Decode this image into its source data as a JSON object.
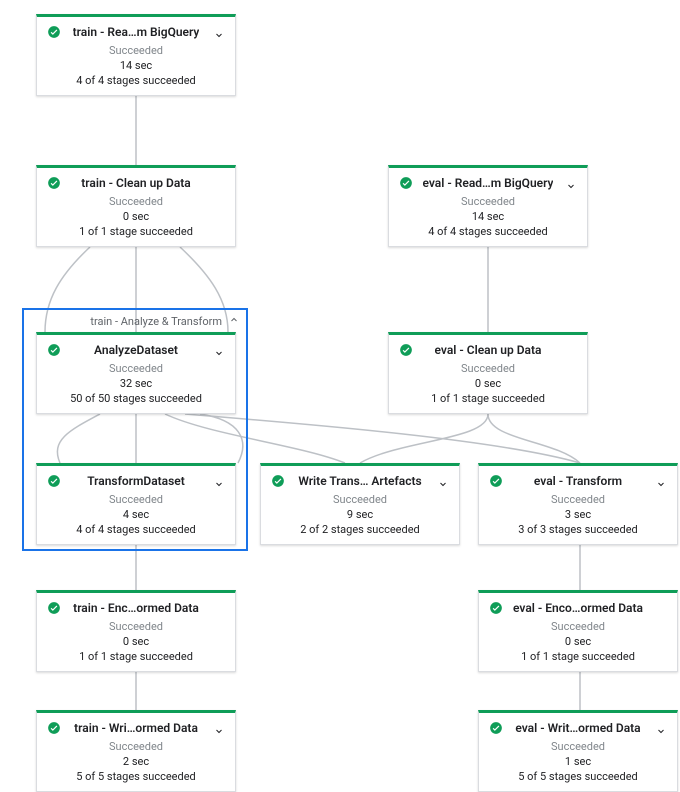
{
  "colors": {
    "success": "#0f9d58",
    "groupBorder": "#1a73e8"
  },
  "group": {
    "label": "train - Analyze & Transform"
  },
  "nodes": {
    "trainRead": {
      "title": "train - Rea…m BigQuery",
      "status": "Succeeded",
      "duration": "14 sec",
      "stages": "4 of 4 stages succeeded",
      "chevron": "down"
    },
    "trainClean": {
      "title": "train - Clean up Data",
      "status": "Succeeded",
      "duration": "0 sec",
      "stages": "1 of 1 stage succeeded",
      "chevron": "none"
    },
    "analyze": {
      "title": "AnalyzeDataset",
      "status": "Succeeded",
      "duration": "32 sec",
      "stages": "50 of 50 stages succeeded",
      "chevron": "down"
    },
    "transform": {
      "title": "TransformDataset",
      "status": "Succeeded",
      "duration": "4 sec",
      "stages": "4 of 4 stages succeeded",
      "chevron": "down"
    },
    "writeArtefacts": {
      "title": "Write Trans… Artefacts",
      "status": "Succeeded",
      "duration": "9 sec",
      "stages": "2 of 2 stages succeeded",
      "chevron": "down"
    },
    "trainEnc": {
      "title": "train - Enc…ormed Data",
      "status": "Succeeded",
      "duration": "0 sec",
      "stages": "1 of 1 stage succeeded",
      "chevron": "none"
    },
    "trainWrite": {
      "title": "train - Wri…ormed Data",
      "status": "Succeeded",
      "duration": "2 sec",
      "stages": "5 of 5 stages succeeded",
      "chevron": "down"
    },
    "evalRead": {
      "title": "eval - Read…m BigQuery",
      "status": "Succeeded",
      "duration": "14 sec",
      "stages": "4 of 4 stages succeeded",
      "chevron": "down"
    },
    "evalClean": {
      "title": "eval - Clean up Data",
      "status": "Succeeded",
      "duration": "0 sec",
      "stages": "1 of 1 stage succeeded",
      "chevron": "none"
    },
    "evalTransform": {
      "title": "eval - Transform",
      "status": "Succeeded",
      "duration": "3 sec",
      "stages": "3 of 3 stages succeeded",
      "chevron": "down"
    },
    "evalEnc": {
      "title": "eval - Enco…ormed Data",
      "status": "Succeeded",
      "duration": "0 sec",
      "stages": "1 of 1 stage succeeded",
      "chevron": "none"
    },
    "evalWrite": {
      "title": "eval - Writ…ormed Data",
      "status": "Succeeded",
      "duration": "1 sec",
      "stages": "5 of 5 stages succeeded",
      "chevron": "down"
    }
  }
}
